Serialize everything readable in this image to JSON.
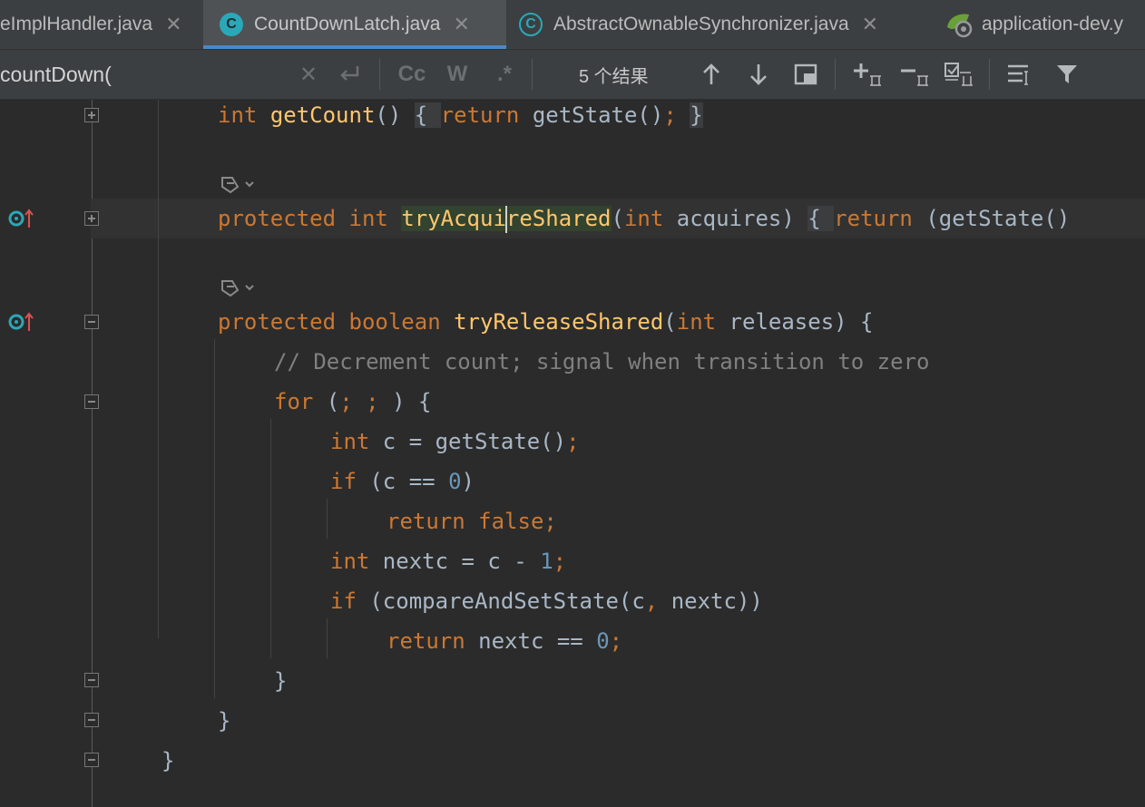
{
  "tabs": [
    {
      "label": "eImplHandler.java",
      "active": false
    },
    {
      "label": "CountDownLatch.java",
      "active": true,
      "icon": "class-icon"
    },
    {
      "label": "AbstractOwnableSynchronizer.java",
      "active": false,
      "icon": "abstract-class-icon"
    },
    {
      "label": "application-dev.y",
      "active": false,
      "icon": "spring-config-icon"
    }
  ],
  "tab_close": "✕",
  "search": {
    "query": "countDown(",
    "case_label": "Cc",
    "word_label": "W",
    "regex_label": ".*",
    "results": "5 个结果"
  },
  "code": {
    "line1": {
      "kw": "int",
      "fn": "getCount",
      "p1": "()",
      "p2": " ",
      "brace_open": "{",
      "p3": " ",
      "ret": "return",
      "p4": " getState()",
      "semi": ";",
      "p5": " ",
      "brace_close": "}"
    },
    "line2": {
      "kw1": "protected",
      "kw2": "int",
      "fn_a": "tryAcqui",
      "fn_b": "reShared",
      "p1": "(",
      "kw3": "int",
      "p2": " acquires) ",
      "brace": "{",
      "p3": " ",
      "ret": "return",
      "p4": " (getState()"
    },
    "line3": {
      "kw1": "protected",
      "kw2": "boolean",
      "fn": "tryReleaseShared",
      "p1": "(",
      "kw3": "int",
      "p2": " releases) {"
    },
    "line4": {
      "comment": "// Decrement count; signal when transition to zero"
    },
    "line5": {
      "kw": "for",
      "p1": " (",
      "semi1": ";",
      "p2": " ",
      "semi2": ";",
      "p3": " ) {"
    },
    "line6": {
      "kw": "int",
      "p1": " c = getState()",
      "semi": ";"
    },
    "line7": {
      "kw": "if",
      "p1": " (c == ",
      "num": "0",
      "p2": ")"
    },
    "line8": {
      "kw": "return",
      "p1": " ",
      "kw2": "false",
      "semi": ";"
    },
    "line9": {
      "kw": "int",
      "p1": " nextc = c - ",
      "num": "1",
      "semi": ";"
    },
    "line10": {
      "kw": "if",
      "p1": " (compareAndSetState(c",
      "comma": ",",
      "p2": " nextc))"
    },
    "line11": {
      "kw": "return",
      "p1": " nextc == ",
      "num": "0",
      "semi": ";"
    },
    "line12": {
      "p": "}"
    },
    "line13": {
      "p": "}"
    },
    "line14": {
      "p": "}"
    }
  }
}
